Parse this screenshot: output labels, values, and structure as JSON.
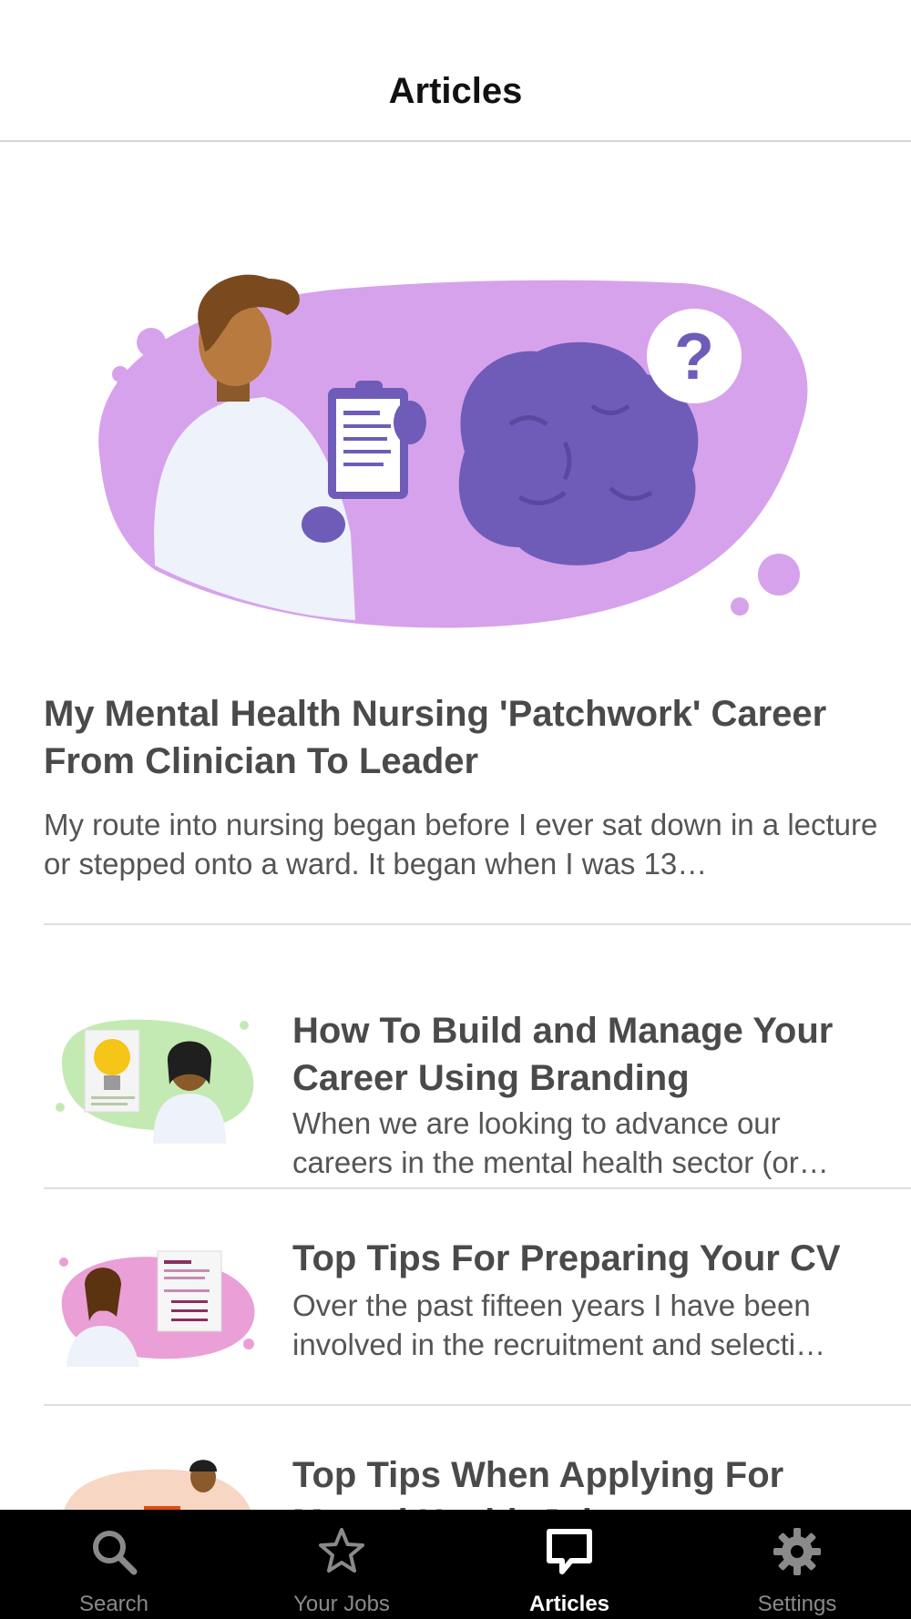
{
  "header": {
    "title": "Articles"
  },
  "featured": {
    "title": "My Mental Health Nursing 'Patchwork' Career From Clinician To Leader",
    "excerpt": "My route into nursing began before I ever sat down in a lecture or stepped onto a ward. It began when I was 13…"
  },
  "articles": [
    {
      "title": "How To Build and Manage Your Career Using Branding",
      "excerpt": "When we are looking to advance our careers in the mental health sector (or…"
    },
    {
      "title": "Top Tips For Preparing Your CV",
      "excerpt": "Over the past fifteen years I have been involved in the recruitment and selecti…"
    },
    {
      "title": "Top Tips When Applying For Mental Health Jobs",
      "excerpt": ""
    }
  ],
  "tabs": [
    {
      "label": "Search",
      "icon": "search-icon"
    },
    {
      "label": "Your Jobs",
      "icon": "star-icon"
    },
    {
      "label": "Articles",
      "icon": "chat-icon",
      "active": true
    },
    {
      "label": "Settings",
      "icon": "gear-icon"
    }
  ],
  "colors": {
    "hero_blob": "#d7a2ec",
    "brain": "#6f5cb8",
    "tab_bar": "#000000",
    "tab_inactive": "#8a8a8a",
    "tab_active": "#ffffff"
  }
}
